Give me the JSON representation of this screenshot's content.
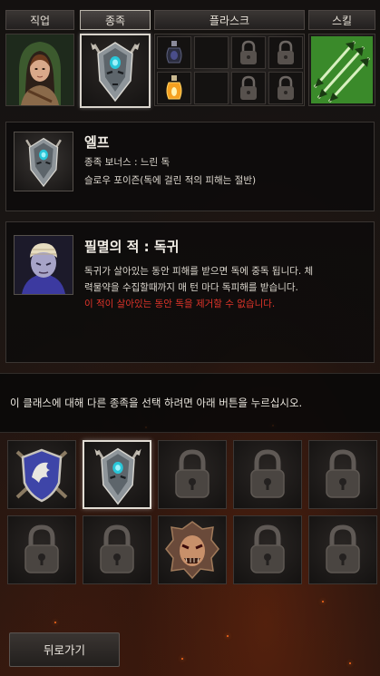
{
  "tabs": {
    "class": "직업",
    "race": "종족",
    "flask": "플라스크",
    "skill": "스킬"
  },
  "race_panel": {
    "name": "엘프",
    "bonus": "종족 보너스 : 느린 독",
    "desc": "슬로우 포이즌(독에 걸린 적의 피해는 절반)"
  },
  "enemy_panel": {
    "title": "필멸의 적 : 독귀",
    "line1": "독귀가 살아있는 동안 피해를 받으면 독에 중독 됩니다. 체",
    "line2": "력물약을 수집할때까지 매 턴 마다 독피해를 받습니다.",
    "warning": "이 적이 살아있는 동안 독을 제거할 수 없습니다."
  },
  "info_text": "이 클래스에 대해 다른 종족을 선택 하려면 아래 버튼을 누르십시오.",
  "race_grid": {
    "rows": [
      [
        "human-shield-icon",
        "elf-mask-icon",
        "lock-icon",
        "lock-icon",
        "lock-icon"
      ],
      [
        "lock-icon",
        "lock-icon",
        "demon-helm-icon",
        "lock-icon",
        "lock-icon"
      ]
    ],
    "selected": "elf-mask-icon"
  },
  "back_button": "뒤로가기",
  "colors": {
    "warning_red": "#e0342a",
    "skill_green": "#3a8a2a"
  }
}
